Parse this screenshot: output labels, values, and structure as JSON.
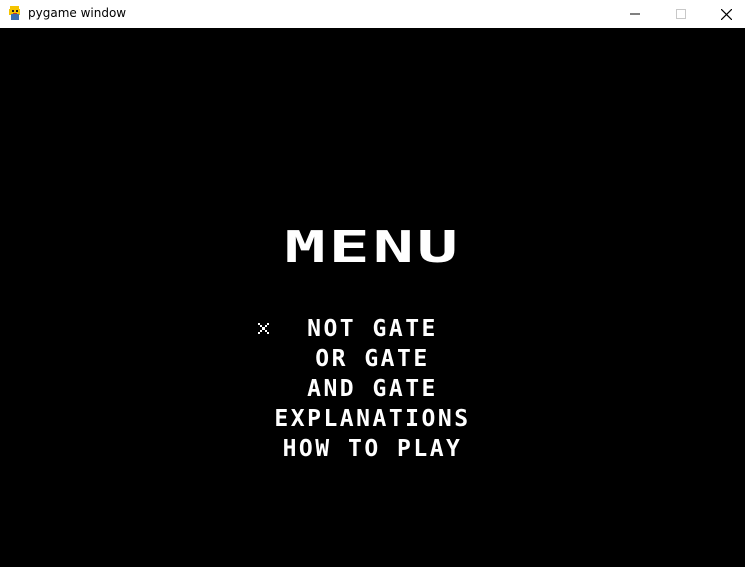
{
  "window": {
    "title": "pygame window",
    "icon": "pygame-snake-icon",
    "controls": {
      "minimize_icon": "minimize-icon",
      "maximize_icon": "maximize-icon",
      "close_icon": "close-icon"
    }
  },
  "game": {
    "background_color": "#000000",
    "text_color": "#ffffff",
    "title": "MENU",
    "selected_index": 0,
    "cursor_icon": "x-cursor-icon",
    "items": [
      {
        "label": "NOT GATE"
      },
      {
        "label": "OR GATE"
      },
      {
        "label": "AND GATE"
      },
      {
        "label": "EXPLANATIONS"
      },
      {
        "label": "HOW TO PLAY"
      }
    ]
  }
}
